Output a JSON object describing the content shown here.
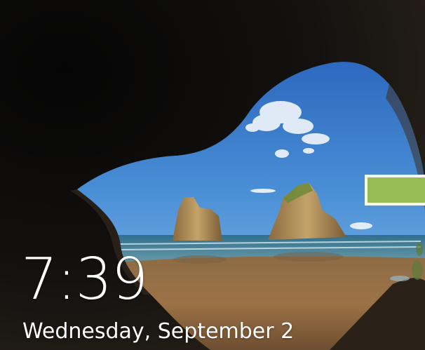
{
  "lock_screen": {
    "time": "7:39",
    "date": "Wednesday, September 2"
  },
  "colors": {
    "highlight_fill": "#99bb55",
    "highlight_border": "#f4f6f0",
    "text": "#ffffff"
  }
}
